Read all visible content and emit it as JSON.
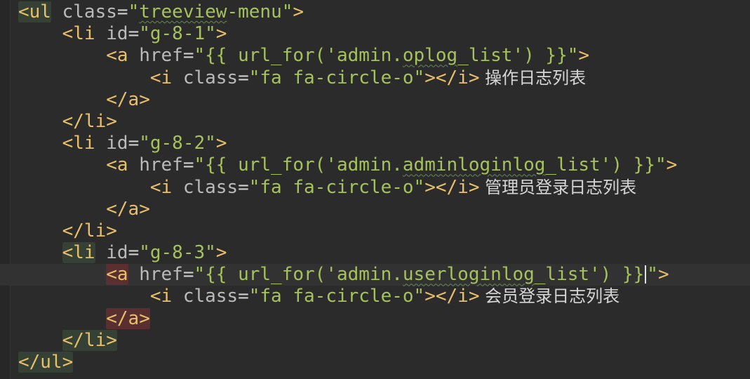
{
  "editor": {
    "lines": [
      {
        "indent": "",
        "tag_open": "<ul",
        "attr": "class",
        "eq": "=",
        "str_prefix": "\"",
        "str_wavy": "treeview",
        "str_suffix": "-menu\"",
        "tag_close": ">",
        "highlight": "green"
      },
      {
        "indent": "    ",
        "tag_open": "<li",
        "attr": "id",
        "eq": "=",
        "str": "\"g-8-1\"",
        "tag_close": ">"
      },
      {
        "indent": "        ",
        "tag_open": "<a",
        "attr": "href",
        "eq": "=",
        "str_prefix": "\"{{ url_for('admin.",
        "str_wavy": "oplog",
        "str_suffix": "_list') }}\"",
        "tag_close": ">"
      },
      {
        "indent": "            ",
        "tag_open": "<i",
        "attr": "class",
        "eq": "=",
        "str": "\"fa fa-circle-o\"",
        "tag_close": "></i>",
        "text": " 操作日志列表"
      },
      {
        "indent": "        ",
        "tag": "</a>"
      },
      {
        "indent": "    ",
        "tag": "</li>"
      },
      {
        "indent": "    ",
        "tag_open": "<li",
        "attr": "id",
        "eq": "=",
        "str": "\"g-8-2\"",
        "tag_close": ">"
      },
      {
        "indent": "        ",
        "tag_open": "<a",
        "attr": "href",
        "eq": "=",
        "str_prefix": "\"{{ url_for('admin.",
        "str_wavy": "adminloginlog",
        "str_suffix": "_list') }}\"",
        "tag_close": ">"
      },
      {
        "indent": "            ",
        "tag_open": "<i",
        "attr": "class",
        "eq": "=",
        "str": "\"fa fa-circle-o\"",
        "tag_close": "></i>",
        "text": " 管理员登录日志列表"
      },
      {
        "indent": "        ",
        "tag": "</a>"
      },
      {
        "indent": "    ",
        "tag": "</li>"
      },
      {
        "indent": "    ",
        "tag_open": "<li",
        "attr": "id",
        "eq": "=",
        "str": "\"g-8-3\"",
        "tag_close": ">",
        "highlight": "green"
      },
      {
        "indent": "        ",
        "tag_open": "<a",
        "attr": "href",
        "eq": "=",
        "str_prefix": "\"{{ url_for('admin.",
        "str_wavy": "userloginlog",
        "str_suffix": "_list') }}",
        "str_after_caret": "\"",
        "tag_close": ">",
        "highlight": "red",
        "caret": true,
        "current": true
      },
      {
        "indent": "            ",
        "tag_open": "<i",
        "attr": "class",
        "eq": "=",
        "str": "\"fa fa-circle-o\"",
        "tag_close": "></i>",
        "text": " 会员登录日志列表"
      },
      {
        "indent": "        ",
        "tag": "</a>",
        "highlight": "red"
      },
      {
        "indent": "    ",
        "tag": "</li>",
        "highlight": "green"
      },
      {
        "indent": "",
        "tag": "</ul>",
        "highlight": "green"
      }
    ]
  }
}
